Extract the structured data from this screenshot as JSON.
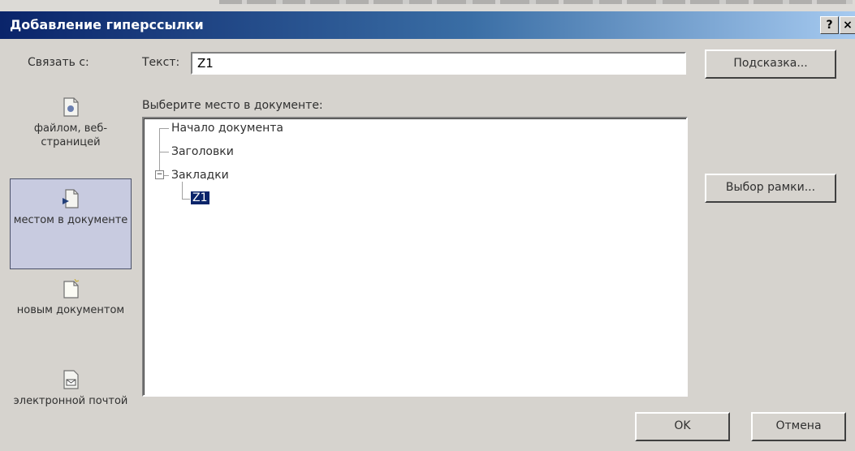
{
  "dialog": {
    "title": "Добавление гиперссылки",
    "help_label": "?",
    "close_label": "×"
  },
  "link_to_label": "Связать с:",
  "text_field": {
    "label": "Текст:",
    "value": "Z1"
  },
  "buttons": {
    "hint": "Подсказка...",
    "frame": "Выбор рамки...",
    "ok": "OK",
    "cancel": "Отмена"
  },
  "places": [
    {
      "label": "файлом, веб-страницей",
      "icon": "web-page-icon",
      "selected": false
    },
    {
      "label": "местом в документе",
      "icon": "document-place-icon",
      "selected": true
    },
    {
      "label": "новым документом",
      "icon": "new-document-icon",
      "selected": false
    },
    {
      "label": "электронной почтой",
      "icon": "email-icon",
      "selected": false
    }
  ],
  "tree": {
    "label": "Выберите место в документе:",
    "items": [
      {
        "label": "Начало документа"
      },
      {
        "label": "Заголовки"
      },
      {
        "label": "Закладки",
        "expanded": true,
        "expander": "−"
      },
      {
        "label": "Z1",
        "selected": true
      }
    ]
  }
}
